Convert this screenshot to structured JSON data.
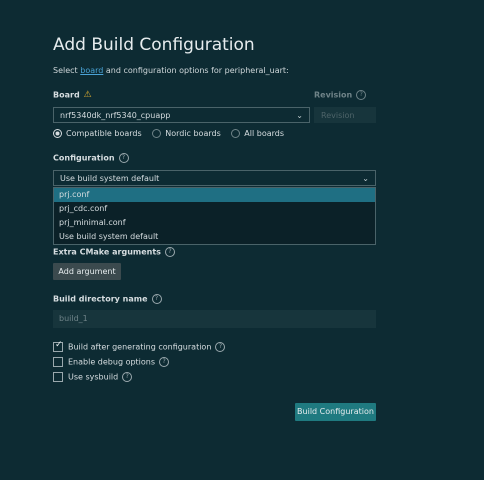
{
  "header": {
    "title": "Add Build Configuration",
    "subtitle_prefix": "Select ",
    "subtitle_link": "board",
    "subtitle_suffix": " and configuration options for peripheral_uart:"
  },
  "board": {
    "label": "Board",
    "value": "nrf5340dk_nrf5340_cpuapp",
    "filters": [
      {
        "label": "Compatible boards",
        "selected": true
      },
      {
        "label": "Nordic boards",
        "selected": false
      },
      {
        "label": "All boards",
        "selected": false
      }
    ]
  },
  "revision": {
    "label": "Revision",
    "placeholder": "Revision"
  },
  "configuration": {
    "label": "Configuration",
    "value": "Use build system default",
    "options": [
      "prj.conf",
      "prj_cdc.conf",
      "prj_minimal.conf",
      "Use build system default"
    ]
  },
  "cmake": {
    "label": "Extra CMake arguments",
    "add_button": "Add argument"
  },
  "build_dir": {
    "label": "Build directory name",
    "value": "build_1"
  },
  "options": [
    {
      "label": "Build after generating configuration",
      "checked": true
    },
    {
      "label": "Enable debug options",
      "checked": false
    },
    {
      "label": "Use sysbuild",
      "checked": false
    }
  ],
  "actions": {
    "submit": "Build Configuration"
  },
  "colors": {
    "background": "#0d2b33",
    "primary": "#1f7a80",
    "link": "#4aa3d6",
    "selected": "#1f6f83",
    "warning": "#e0b030"
  }
}
